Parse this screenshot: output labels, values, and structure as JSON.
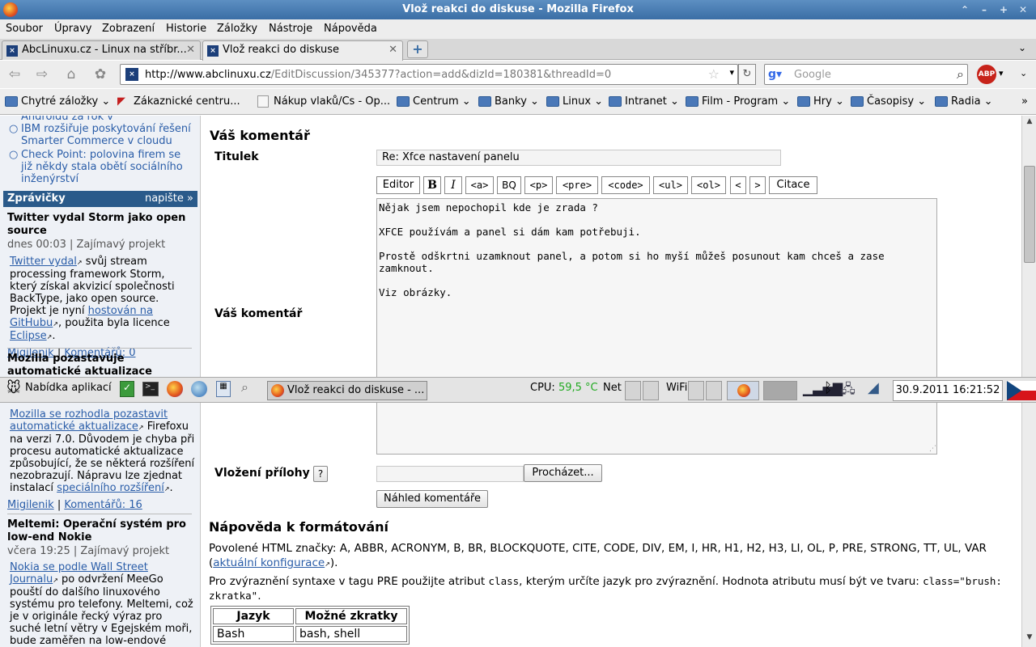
{
  "window": {
    "title": "Vlož reakci do diskuse - Mozilla Firefox",
    "min": "–",
    "max": "+",
    "close": "✕",
    "up": "⌃"
  },
  "menu": [
    "Soubor",
    "Úpravy",
    "Zobrazení",
    "Historie",
    "Záložky",
    "Nástroje",
    "Nápověda"
  ],
  "tabs": [
    {
      "label": "AbcLinuxu.cz - Linux na stříbr...",
      "active": false
    },
    {
      "label": "Vlož reakci do diskuse",
      "active": true
    }
  ],
  "tab_close": "✕",
  "nav": {
    "url_host": "http://www.abclinuxu.cz",
    "url_rest": "/EditDiscussion/345377?action=add&dizId=180381&threadId=0",
    "search_placeholder": "Google",
    "abp": "ABP"
  },
  "bookmarks": [
    "Chytré záložky",
    "Zákaznické centru...",
    "Nákup vlaků/Cs - Op...",
    "Centrum",
    "Banky",
    "Linux",
    "Intranet",
    "Film - Program",
    "Hry",
    "Časopisy",
    "Radia"
  ],
  "sidebar": {
    "top_items": [
      "Androidu za rok v",
      "IBM rozšiřuje poskytování řešení Smarter Commerce v cloudu",
      "Check Point: polovina firem se již někdy stala obětí sociálního inženýrství"
    ],
    "section_title": "Zprávičky",
    "section_more": "napište »",
    "news": [
      {
        "title": "Twitter vydal Storm jako open source",
        "meta": "dnes 00:03 | Zajímavý projekt",
        "body_parts": [
          "Twitter vydal",
          " svůj stream processing framework Storm, který získal akvizicí společnosti BackType, jako open source. Projekt je nyní ",
          "hostován na GitHubu",
          ", použita byla licence ",
          "Eclipse",
          "."
        ],
        "author": "Migilenik",
        "comments": "Komentářů: 0"
      },
      {
        "title": "Mozilla pozastavuje automatické aktualizace",
        "body_parts": [
          "Mozilla se rozhodla pozastavit automatické aktualizace",
          " Firefoxu na verzi 7.0. Důvodem je chyba při procesu automatické aktualizace způsobující, že se některá rozšíření nezobrazují. Nápravu lze zjednat instalací ",
          "speciálního rozšíření",
          "."
        ],
        "author": "Migilenik",
        "comments": "Komentářů: 16"
      },
      {
        "title": "Meltemi: Operační systém pro low-end Nokie",
        "meta": "včera 19:25 | Zajímavý projekt",
        "body_parts": [
          "Nokia se podle Wall Street Journalu",
          " po odvržení MeeGo pouští do dalšího linuxového systému pro telefony. Meltemi, což je v originále řecký výraz pro suché letní větry v Egejském moři, bude zaměřen na low-endové telefony, ty totiž tvoří"
        ]
      }
    ]
  },
  "form": {
    "heading": "Váš komentář",
    "title_label": "Titulek",
    "title_value": "Re: Xfce nastavení panelu",
    "comment_label": "Váš komentář",
    "toolbar": [
      "Editor",
      "B",
      "I",
      "<a>",
      "BQ",
      "<p>",
      "<pre>",
      "<code>",
      "<ul>",
      "<ol>",
      "<",
      ">",
      "Citace"
    ],
    "comment_text": "Nějak jsem nepochopil kde je zrada ?\n\nXFCE používám a panel si dám kam potřebuji.\n\nProstě odškrtni uzamknout panel, a potom si ho myší můžeš posunout kam chceš a zase zamknout.\n\nViz obrázky.",
    "attach_label": "Vložení přílohy",
    "attach_help": "?",
    "browse": "Procházet...",
    "preview": "Náhled komentáře"
  },
  "help": {
    "heading": "Nápověda k formátování",
    "allowed_tags": "Povolené HTML značky: A, ABBR, ACRONYM, B, BR, BLOCKQUOTE, CITE, CODE, DIV, EM, I, HR, H1, H2, H3, LI, OL, P, PRE, STRONG, TT, UL, VAR",
    "config_link": "aktuální konfigurace",
    "syntax_a": "Pro zvýraznění syntaxe v tagu PRE použijte atribut ",
    "syntax_code1": "class",
    "syntax_b": ", kterým určíte jazyk pro zvýraznění. Hodnota atributu musí být ve tvaru: ",
    "syntax_code2": "class=\"brush: zkratka\"",
    "syntax_c": ".",
    "table_headers": [
      "Jazyk",
      "Možné zkratky"
    ],
    "table_rows": [
      [
        "Bash",
        "bash, shell"
      ]
    ]
  },
  "panel": {
    "menu": "Nabídka aplikací",
    "task": "Vlož reakci do diskuse - ...",
    "cpu_label": "CPU:",
    "cpu_value": "59,5 °C",
    "net": "Net",
    "wifi": "WiFi",
    "clock": "30.9.2011 16:21:52"
  },
  "colors": {
    "accent": "#2a5a8a",
    "link": "#2a5da8",
    "cpu": "#22aa22"
  }
}
